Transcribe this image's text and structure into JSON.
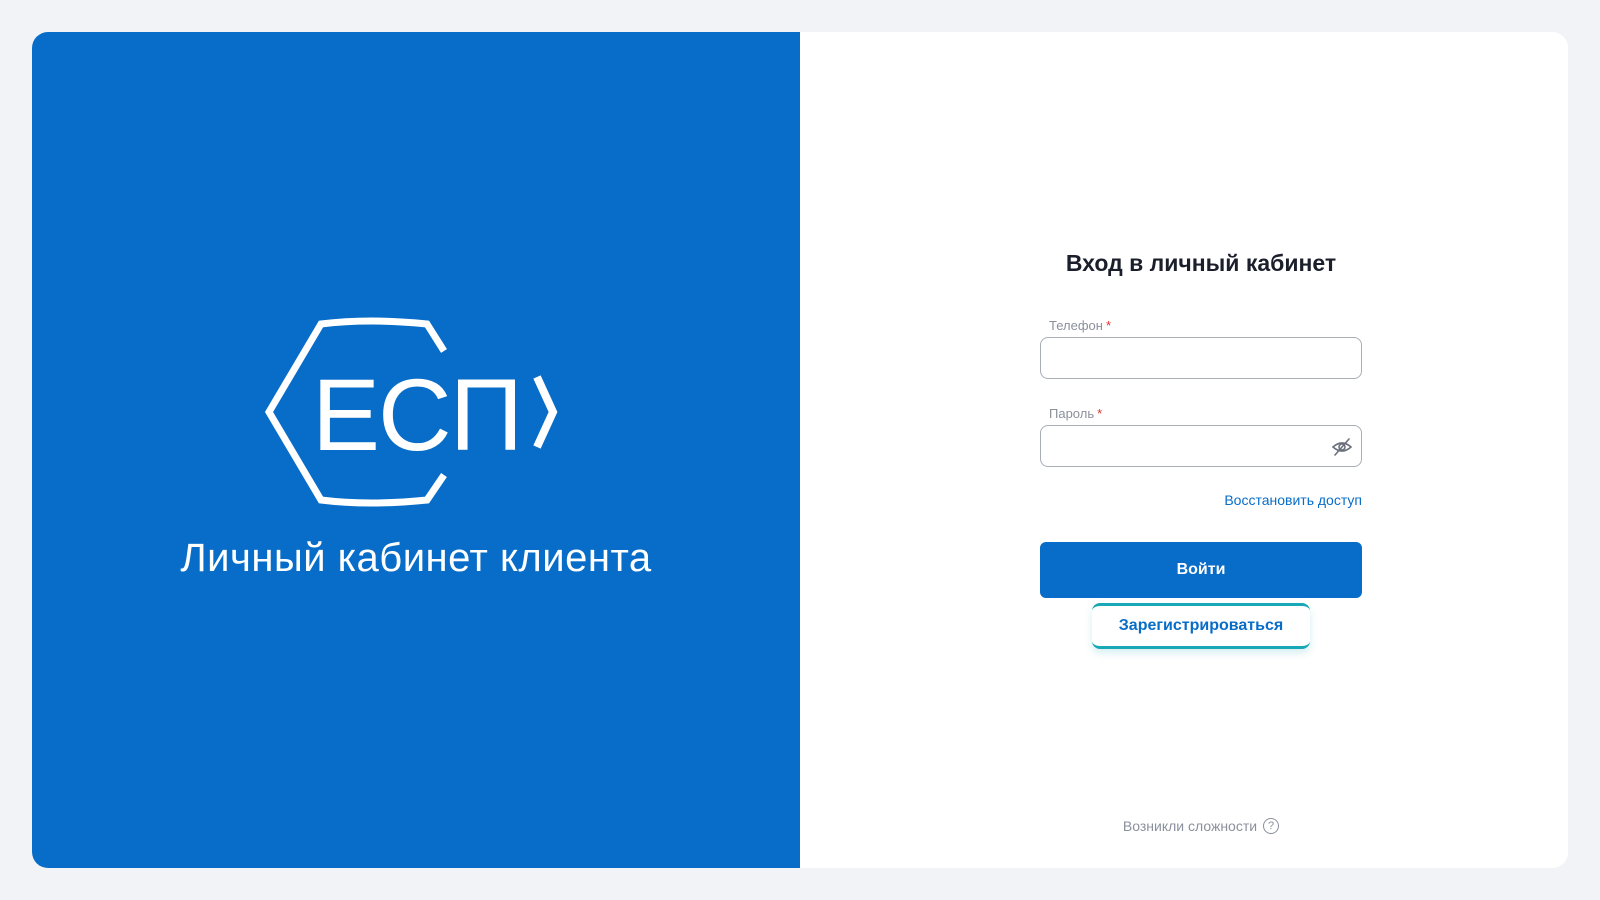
{
  "brand": {
    "logo_text": "ЕСП",
    "caption": "Личный кабинет клиента",
    "background_color": "#086dc8"
  },
  "form": {
    "title": "Вход в личный кабинет",
    "phone": {
      "label": "Телефон",
      "required_mark": "*",
      "value": "",
      "placeholder": ""
    },
    "password": {
      "label": "Пароль",
      "required_mark": "*",
      "value": "",
      "placeholder": "",
      "toggle_icon": "eye-off-icon"
    },
    "recover_link": "Восстановить доступ",
    "login_button": "Войти",
    "register_button": "Зарегистрироваться",
    "help_text": "Возникли сложности",
    "help_icon": "question-circle-icon"
  },
  "colors": {
    "accent": "#086dc8",
    "teal": "#19a8b7",
    "required": "#e03030"
  }
}
